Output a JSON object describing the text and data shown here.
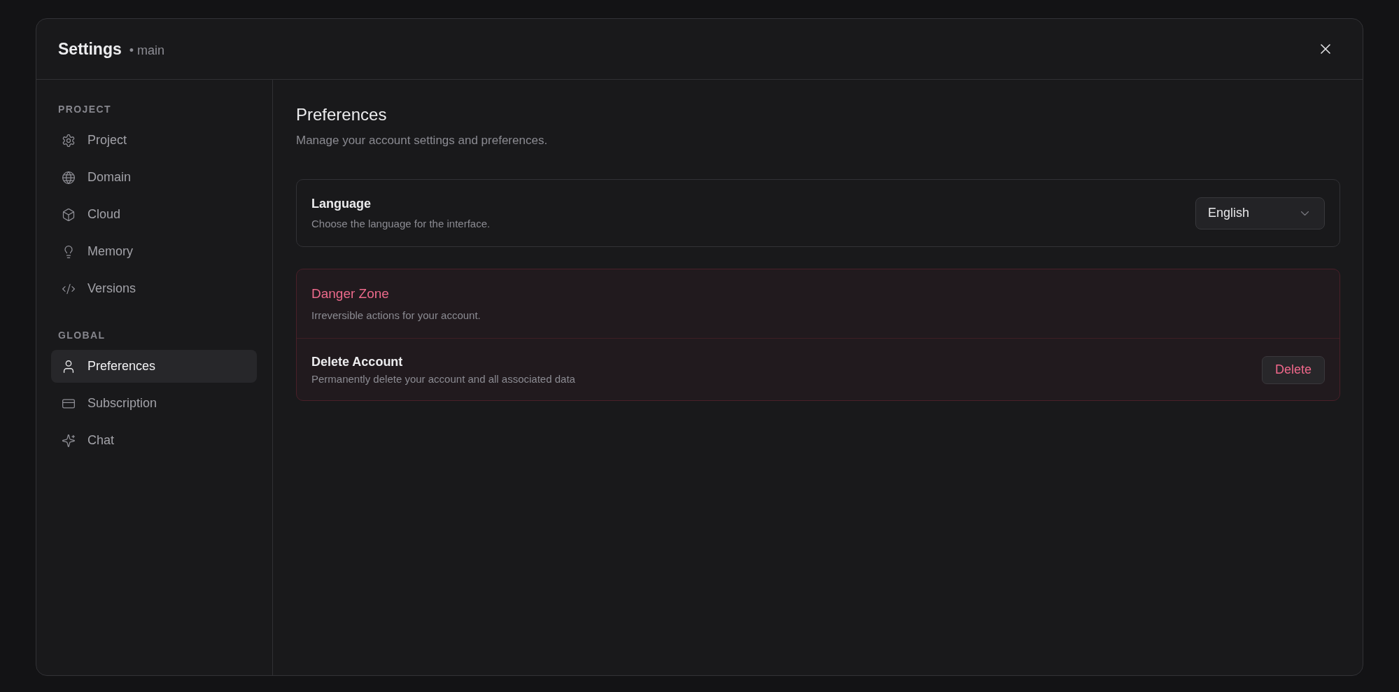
{
  "dialog": {
    "title": "Settings",
    "subtitle": "• main"
  },
  "sidebar": {
    "sections": [
      {
        "label": "PROJECT",
        "items": [
          {
            "label": "Project",
            "selected": false
          },
          {
            "label": "Domain",
            "selected": false
          },
          {
            "label": "Cloud",
            "selected": false
          },
          {
            "label": "Memory",
            "selected": false
          },
          {
            "label": "Versions",
            "selected": false
          }
        ]
      },
      {
        "label": "GLOBAL",
        "items": [
          {
            "label": "Preferences",
            "selected": true
          },
          {
            "label": "Subscription",
            "selected": false
          },
          {
            "label": "Chat",
            "selected": false
          }
        ]
      }
    ]
  },
  "content": {
    "title": "Preferences",
    "subtitle": "Manage your account settings and preferences.",
    "language": {
      "label": "Language",
      "description": "Choose the language for the interface.",
      "value": "English"
    },
    "danger_zone": {
      "title": "Danger Zone",
      "description": "Irreversible actions for your account.",
      "actions": [
        {
          "label": "Delete Account",
          "description": "Permanently delete your account and all associated data",
          "button": "Delete"
        }
      ]
    }
  }
}
